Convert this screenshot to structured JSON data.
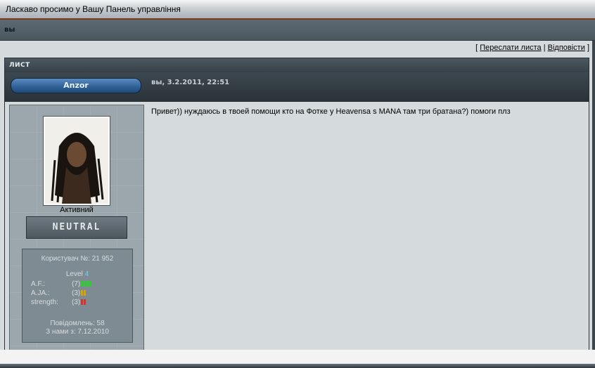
{
  "header": {
    "title": "Ласкаво просимо у Вашу Панель управління"
  },
  "breadcrumb": {
    "label": "вы"
  },
  "actions": {
    "forward_label": "Переслати листа",
    "reply_label": "Відповісти",
    "open_bracket": "[",
    "separator": "|",
    "close_bracket": "]"
  },
  "message_box": {
    "heading": "ЛИСТ",
    "author": "Anzor",
    "meta": "вы, 3.2.2011, 22:51",
    "body": "Привет)) нуждаюсь в твоей помощи кто на Фотке у Heavensa s MANA там три братана?) помоги плз"
  },
  "user": {
    "status": "Активний",
    "rank": "NEUTRAL",
    "user_number": "Користувач №: 21 952",
    "level_label": "Level",
    "level_value": "4",
    "attributes": [
      {
        "name": "A.F.:",
        "value": "(7)",
        "color": "#2ecc2e",
        "bars": 4
      },
      {
        "name": "A.JA.:",
        "value": "(3)",
        "color": "#d6a400",
        "bars": 2
      },
      {
        "name": "strength:",
        "value": "(3)",
        "color": "#d6322e",
        "bars": 2
      }
    ],
    "posts": "Повідомлень: 58",
    "joined": "З нами з: 7.12.2010"
  }
}
